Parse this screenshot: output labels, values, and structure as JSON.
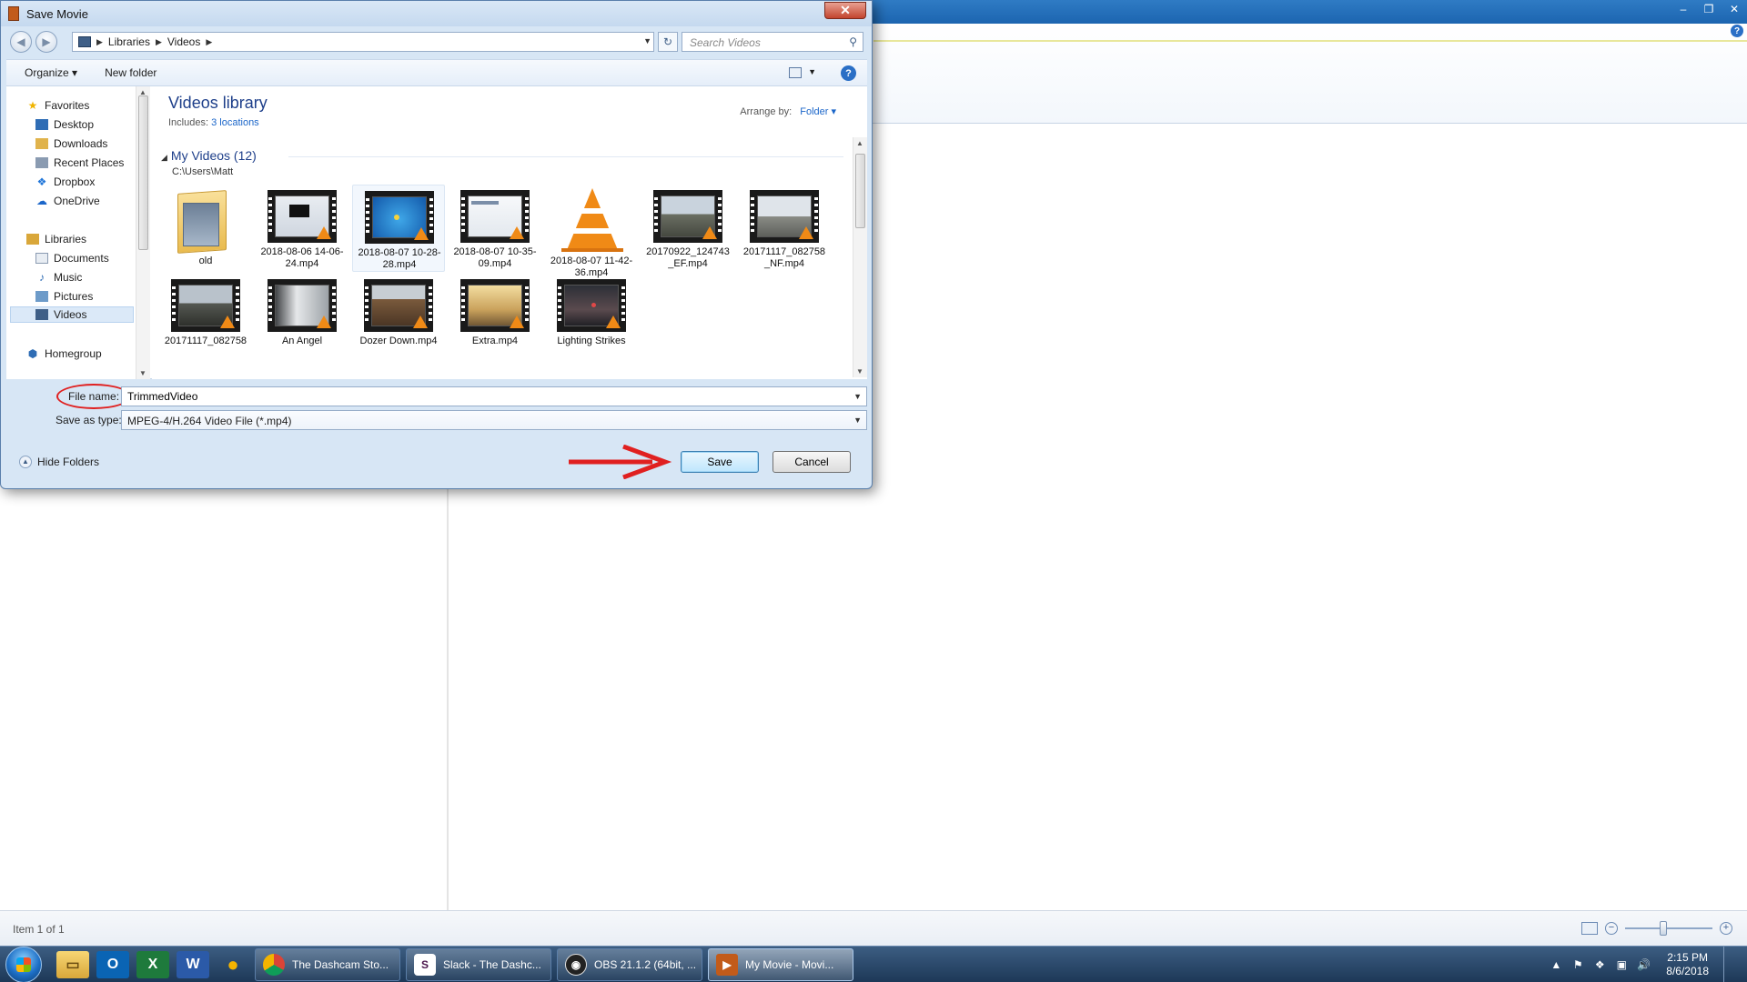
{
  "background_app": {
    "status_text": "Item 1 of 1",
    "window_buttons": [
      "–",
      "❐",
      "✕"
    ],
    "help_glyph": "?"
  },
  "dialog": {
    "title": "Save Movie",
    "close_glyph": "✕",
    "breadcrumb": [
      "Libraries",
      "Videos"
    ],
    "search_placeholder": "Search Videos",
    "toolbar": {
      "organize": "Organize ▾",
      "new_folder": "New folder",
      "help_glyph": "?"
    },
    "nav": {
      "favorites": "Favorites",
      "favorites_items": [
        "Desktop",
        "Downloads",
        "Recent Places",
        "Dropbox",
        "OneDrive"
      ],
      "libraries": "Libraries",
      "libraries_items": [
        "Documents",
        "Music",
        "Pictures",
        "Videos"
      ],
      "selected_item": "Videos",
      "homegroup": "Homegroup"
    },
    "library": {
      "title": "Videos library",
      "includes_label": "Includes:",
      "includes_link": "3 locations",
      "arrange_label": "Arrange by:",
      "arrange_value": "Folder ▾",
      "group_title": "My Videos (12)",
      "group_path": "C:\\Users\\Matt"
    },
    "files": [
      {
        "name": "old",
        "kind": "folder"
      },
      {
        "name": "2018-08-06 14-06-24.mp4",
        "kind": "video"
      },
      {
        "name": "2018-08-07 10-28-28.mp4",
        "kind": "video",
        "selected": true
      },
      {
        "name": "2018-08-07 10-35-09.mp4",
        "kind": "video"
      },
      {
        "name": "2018-08-07 11-42-36.mp4",
        "kind": "vlc"
      },
      {
        "name": "20170922_124743 _EF.mp4",
        "kind": "video"
      },
      {
        "name": "20171117_082758 _NF.mp4",
        "kind": "video"
      },
      {
        "name": "20171117_082758",
        "kind": "video"
      },
      {
        "name": "An Angel",
        "kind": "video"
      },
      {
        "name": "Dozer Down.mp4",
        "kind": "video"
      },
      {
        "name": "Extra.mp4",
        "kind": "video"
      },
      {
        "name": "Lighting Strikes",
        "kind": "video"
      }
    ],
    "file_name_label": "File name:",
    "file_name_value": "TrimmedVideo",
    "save_as_type_label": "Save as type:",
    "save_as_type_value": "MPEG-4/H.264 Video File (*.mp4)",
    "hide_folders": "Hide Folders",
    "save_label": "Save",
    "cancel_label": "Cancel"
  },
  "taskbar": {
    "pinned": [
      "File Explorer",
      "Outlook",
      "Excel",
      "Word",
      "Chat"
    ],
    "apps": [
      {
        "label": "The Dashcam Sto...",
        "icon": "chrome-icon"
      },
      {
        "label": "Slack - The Dashc...",
        "icon": "slack-icon"
      },
      {
        "label": "OBS 21.1.2 (64bit, ...",
        "icon": "obs-icon"
      },
      {
        "label": "My Movie - Movi...",
        "icon": "movie-maker-icon",
        "active": true
      }
    ],
    "time": "2:15 PM",
    "date": "8/6/2018"
  },
  "colors": {
    "accent": "#1e3f8a",
    "link": "#1b66c9",
    "annotation": "#e02020"
  }
}
